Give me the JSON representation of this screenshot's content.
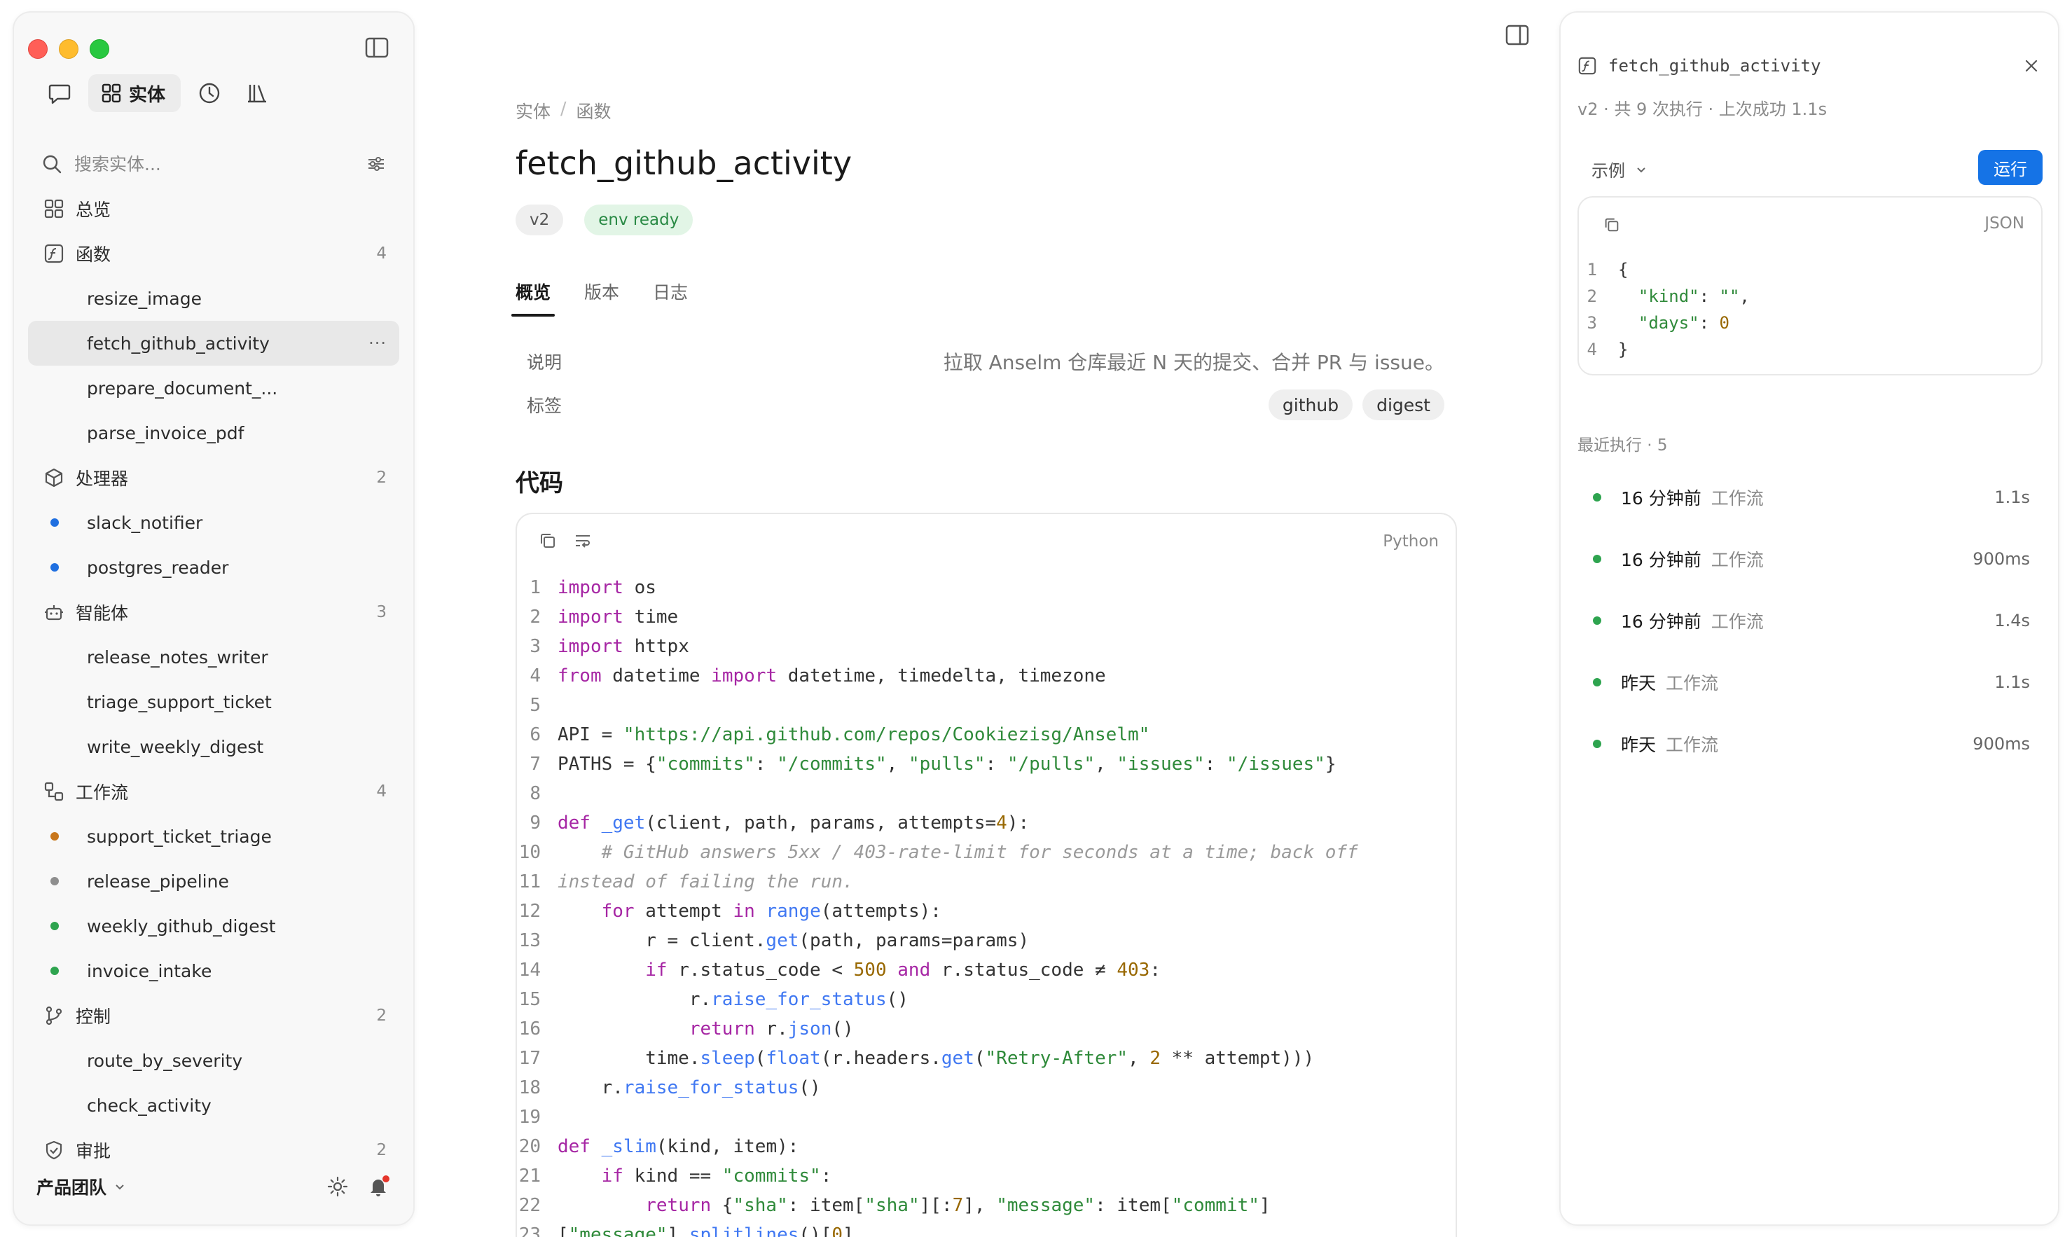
{
  "sidebar": {
    "modes": {
      "entities_label": "实体"
    },
    "search": {
      "placeholder": "搜索实体..."
    },
    "overview": {
      "label": "总览"
    },
    "groups": {
      "functions": {
        "label": "函数",
        "count": "4",
        "items": [
          "resize_image",
          "fetch_github_activity",
          "prepare_document_...",
          "parse_invoice_pdf"
        ]
      },
      "processors": {
        "label": "处理器",
        "count": "2",
        "items": [
          "slack_notifier",
          "postgres_reader"
        ],
        "dot_color": "#1f6fe0"
      },
      "agents": {
        "label": "智能体",
        "count": "3",
        "items": [
          "release_notes_writer",
          "triage_support_ticket",
          "write_weekly_digest"
        ]
      },
      "workflows": {
        "label": "工作流",
        "count": "4",
        "items": [
          "support_ticket_triage",
          "release_pipeline",
          "weekly_github_digest",
          "invoice_intake"
        ],
        "dot_colors": [
          "#c8761b",
          "#8e8e8e",
          "#2ea44f",
          "#2ea44f"
        ]
      },
      "controls": {
        "label": "控制",
        "count": "2",
        "items": [
          "route_by_severity",
          "check_activity"
        ]
      },
      "approvals": {
        "label": "审批",
        "count": "2"
      }
    },
    "footer": {
      "team": "产品团队"
    }
  },
  "main": {
    "breadcrumb": {
      "root": "实体",
      "sep": "/",
      "current": "函数"
    },
    "title": "fetch_github_activity",
    "badges": {
      "version": "v2",
      "env": "env ready"
    },
    "tabs": [
      "概览",
      "版本",
      "日志"
    ],
    "properties": {
      "desc_key": "说明",
      "desc_value": "拉取 Anselm 仓库最近 N 天的提交、合并 PR 与 issue。",
      "tags_key": "标签",
      "tags": [
        "github",
        "digest"
      ]
    },
    "code_section": "代码",
    "code": {
      "language": "Python",
      "line_numbers": [
        "1",
        "2",
        "3",
        "4",
        "5",
        "6",
        "7",
        "8",
        "9",
        "10",
        "11",
        "12",
        "13",
        "14",
        "15",
        "16",
        "17",
        "18",
        "19",
        "20",
        "21",
        "22",
        "23"
      ]
    }
  },
  "panel": {
    "title": "fetch_github_activity",
    "meta": "v2 · 共 9 次执行 · 上次成功 1.1s",
    "example_label": "示例",
    "run_label": "运行",
    "json": {
      "language": "JSON",
      "line_numbers": [
        "1",
        "2",
        "3",
        "4"
      ]
    },
    "recent": {
      "title": "最近执行 · 5",
      "runs": [
        {
          "when": "16 分钟前",
          "kind": "工作流",
          "duration": "1.1s"
        },
        {
          "when": "16 分钟前",
          "kind": "工作流",
          "duration": "900ms"
        },
        {
          "when": "16 分钟前",
          "kind": "工作流",
          "duration": "1.4s"
        },
        {
          "when": "昨天",
          "kind": "工作流",
          "duration": "1.1s"
        },
        {
          "when": "昨天",
          "kind": "工作流",
          "duration": "900ms"
        }
      ],
      "status_color": "#2ea44f"
    }
  },
  "colors": {
    "accent": "#1573e6",
    "env_ready_bg": "#e2f5e6",
    "env_ready_fg": "#2a8a45"
  }
}
